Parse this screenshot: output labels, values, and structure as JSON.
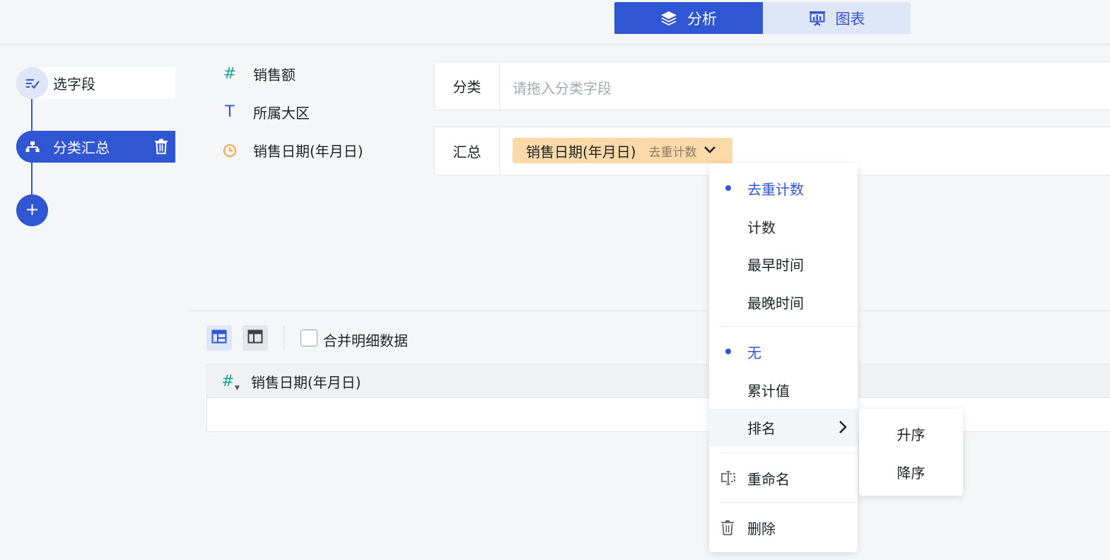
{
  "top_tabs": {
    "analysis": {
      "label": "分析",
      "icon": "layers-icon",
      "active": true
    },
    "chart": {
      "label": "图表",
      "icon": "presentation-chart-icon",
      "active": false
    }
  },
  "steps": {
    "select_fields": {
      "label": "选字段",
      "icon": "checklist-icon"
    },
    "group_summary": {
      "label": "分类汇总",
      "icon": "hierarchy-icon",
      "delete_icon": "trash-icon"
    },
    "add_icon": "plus-icon"
  },
  "fields": [
    {
      "icon": "#",
      "icon_name": "number-type-icon",
      "icon_color": "#20a493",
      "name": "销售额"
    },
    {
      "icon": "T",
      "icon_name": "text-type-icon",
      "icon_color": "#3056d3",
      "name": "所属大区"
    },
    {
      "icon": "date",
      "icon_name": "clock-icon",
      "icon_color": "#f5a33b",
      "name": "销售日期(年月日)"
    }
  ],
  "config": {
    "category": {
      "label": "分类",
      "placeholder": "请拖入分类字段"
    },
    "summary": {
      "label": "汇总",
      "chip_field": "销售日期(年月日)",
      "chip_aggregation": "去重计数"
    }
  },
  "dropdown": {
    "aggregations": [
      {
        "label": "去重计数",
        "selected": true
      },
      {
        "label": "计数",
        "selected": false
      },
      {
        "label": "最早时间",
        "selected": false
      },
      {
        "label": "最晚时间",
        "selected": false
      }
    ],
    "calculations": [
      {
        "label": "无",
        "selected": true
      },
      {
        "label": "累计值",
        "selected": false
      },
      {
        "label": "排名",
        "selected": false,
        "has_submenu": true
      }
    ],
    "rename": "重命名",
    "delete": "删除"
  },
  "submenu": {
    "ascending": "升序",
    "descending": "降序"
  },
  "result": {
    "merge_label": "合并明细数据",
    "merge_checked": false,
    "column_header": "销售日期(年月日)"
  },
  "colors": {
    "primary": "#3056d3",
    "chip": "#fbd9a8",
    "number": "#20a493",
    "date": "#f5a33b"
  }
}
